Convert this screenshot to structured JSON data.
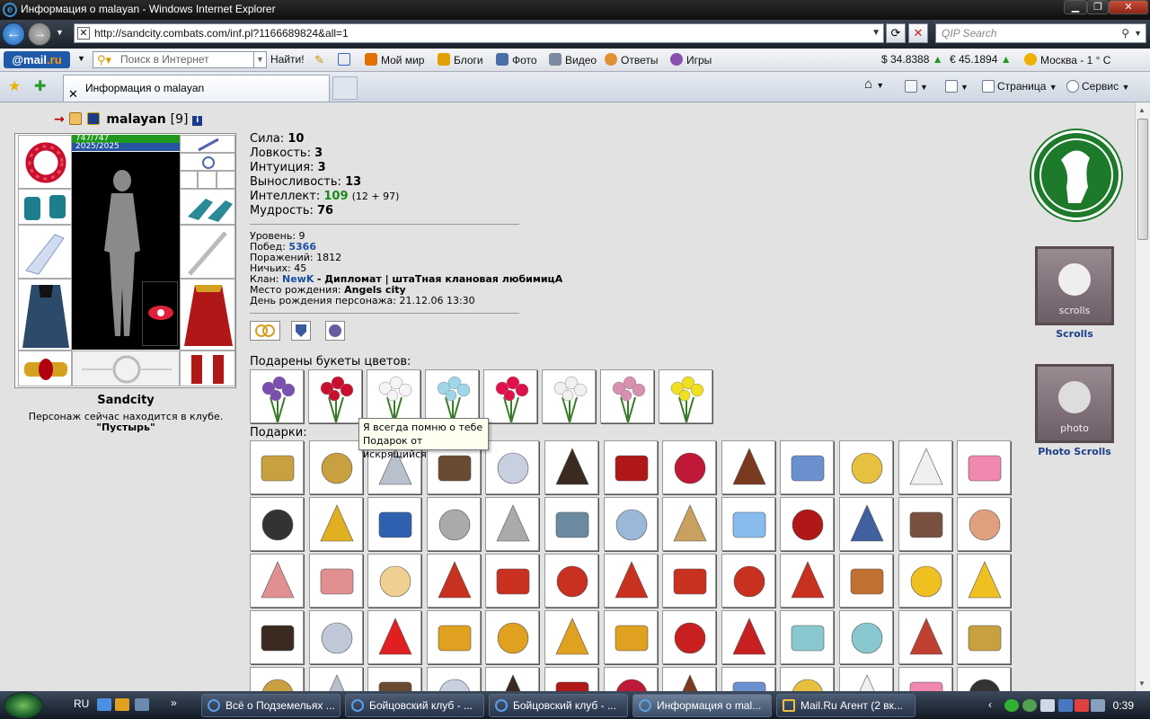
{
  "window": {
    "title": "Информация о malayan - Windows Internet Explorer"
  },
  "address": {
    "url": "http://sandcity.combats.com/inf.pl?1166689824&all=1",
    "search_placeholder": "QIP Search"
  },
  "toolbar": {
    "brand_prefix": "@mail",
    "brand_suffix": ".ru",
    "search_placeholder": "Поиск в Интернет",
    "find_label": "Найти!",
    "items": [
      "Мой мир",
      "Блоги",
      "Фото",
      "Видео",
      "Ответы",
      "Игры"
    ],
    "usd": "$ 34.8388",
    "eur": "€ 45.1894",
    "weather": "Москва - 1 ° C"
  },
  "tabs": {
    "active_label": "Информация о malayan",
    "page_menu": "Страница",
    "service_menu": "Сервис"
  },
  "character": {
    "arrow": "→",
    "name": "malayan",
    "level_tag": "[9]",
    "hp": "747/747",
    "mp": "2025/2025",
    "city": "Sandcity",
    "location_text": "Персонаж сейчас находится в клубе.",
    "location_name": "\"Пустырь\""
  },
  "stats": {
    "strength_label": "Сила:",
    "strength": "10",
    "agility_label": "Ловкость:",
    "agility": "3",
    "intuition_label": "Интуиция:",
    "intuition": "3",
    "endurance_label": "Выносливость:",
    "endurance": "13",
    "intellect_label": "Интеллект:",
    "intellect": "109",
    "intellect_detail": "(12 + 97)",
    "wisdom_label": "Мудрость:",
    "wisdom": "76"
  },
  "info": {
    "level_label": "Уровень:",
    "level": "9",
    "wins_label": "Побед:",
    "wins": "5366",
    "losses_label": "Поражений:",
    "losses": "1812",
    "draws_label": "Ничьих:",
    "draws": "45",
    "clan_label": "Клан:",
    "clan": "NewK",
    "clan_title": "- Дипломат | штаТная клановая любимицА",
    "birthplace_label": "Место рождения:",
    "birthplace": "Angels city",
    "birthday_label": "День рождения персонажа:",
    "birthday": "21.12.06 13:30"
  },
  "gifts": {
    "bouquets_title": "Подарены букеты цветов:",
    "gifts_title": "Подарки:",
    "tooltip_line1": "Я всегда помню о тебе",
    "tooltip_line2": "Подарок от искрящийся"
  },
  "sidebar": {
    "scrolls_label": "Scrolls",
    "scrolls_banner_text": "scrolls",
    "photo_label": "Photo Scrolls",
    "photo_banner_text": "photo"
  },
  "taskbar": {
    "lang": "RU",
    "items": [
      "Всё о Подземельях ...",
      "Бойцовский клуб - ...",
      "Бойцовский клуб - ...",
      "Информация о mal...",
      "Mail.Ru Агент (2 вк..."
    ],
    "clock": "0:39"
  },
  "colors": {
    "hp": "#1f9a1f",
    "mp": "#2554a0",
    "link_blue": "#1b4fa0",
    "intellect_green": "#1a8a1a",
    "logo_green": "#1d7a2a"
  }
}
